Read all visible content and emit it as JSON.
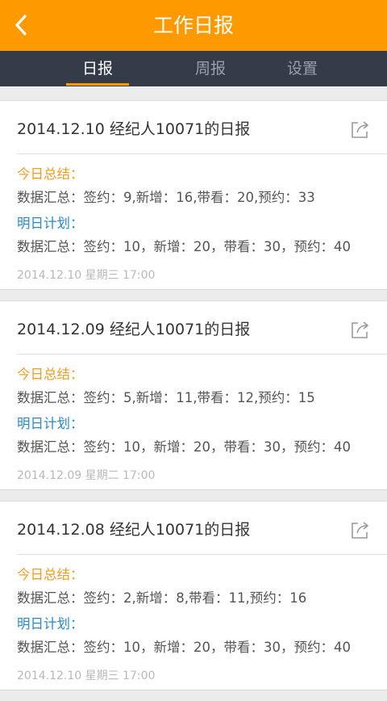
{
  "header": {
    "title": "工作日报",
    "back_icon": "chevron-left-icon"
  },
  "tabs": [
    {
      "label": "日报",
      "active": true
    },
    {
      "label": "周报",
      "active": false
    },
    {
      "label": "设置",
      "active": false
    }
  ],
  "colors": {
    "brand": "#ff9900",
    "tab_bar": "#343c49",
    "summary_heading": "#f29b1d",
    "plan_heading": "#2a8ac8"
  },
  "reports": [
    {
      "title": "2014.12.10 经纪人10071的日报",
      "summary_heading": "今日总结：",
      "summary": "数据汇总：签约：9,新增：16,带看：20,预约：33",
      "plan_heading": "明日计划：",
      "plan": "数据汇总：签约：10，新增：20，带看：30，预约：40",
      "timestamp": "2014.12.10 星期三 17:00"
    },
    {
      "title": "2014.12.09 经纪人10071的日报",
      "summary_heading": "今日总结：",
      "summary": "数据汇总：签约：5,新增：11,带看：12,预约：15",
      "plan_heading": "明日计划：",
      "plan": "数据汇总：签约：10，新增：20，带看：30，预约：40",
      "timestamp": "2014.12.09 星期二 17:00"
    },
    {
      "title": "2014.12.08 经纪人10071的日报",
      "summary_heading": "今日总结：",
      "summary": "数据汇总：签约：2,新增：8,带看：11,预约：16",
      "plan_heading": "明日计划：",
      "plan": "数据汇总：签约：10，新增：20，带看：30，预约：40",
      "timestamp": "2014.12.10 星期三 17:00"
    }
  ]
}
